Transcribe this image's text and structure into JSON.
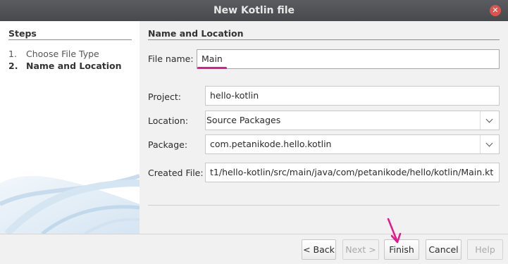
{
  "window": {
    "title": "New Kotlin file",
    "close_icon": "close-icon",
    "accent": "#e6178a"
  },
  "steps": {
    "title": "Steps",
    "items": [
      {
        "num": "1.",
        "label": "Choose File Type"
      },
      {
        "num": "2.",
        "label": "Name and Location"
      }
    ]
  },
  "main": {
    "title": "Name and Location",
    "file_name": {
      "label": "File name:",
      "value": "Main"
    },
    "project": {
      "label": "Project:",
      "value": "hello-kotlin"
    },
    "location": {
      "label": "Location:",
      "value": "Source Packages"
    },
    "package": {
      "label": "Package:",
      "value": "com.petanikode.hello.kotlin"
    },
    "created_file": {
      "label": "Created File:",
      "value": "t1/hello-kotlin/src/main/java/com/petanikode/hello/kotlin/Main.kt"
    }
  },
  "footer": {
    "back": "< Back",
    "next": "Next >",
    "finish": "Finish",
    "cancel": "Cancel",
    "help": "Help"
  }
}
